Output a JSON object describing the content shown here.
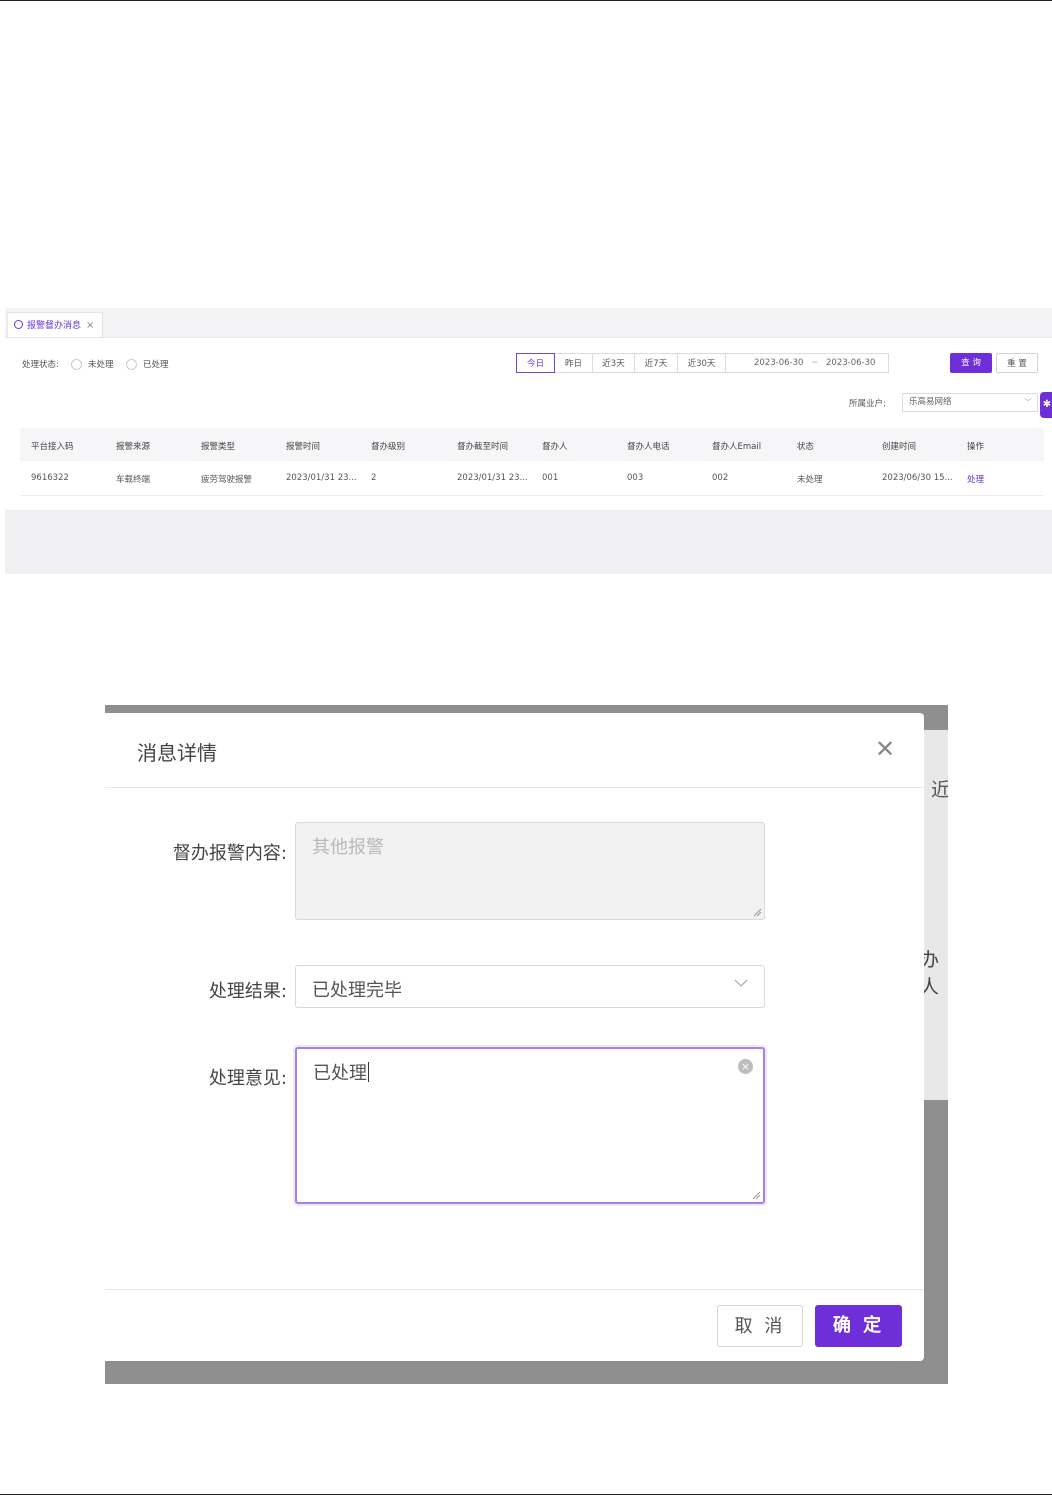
{
  "list_page": {
    "tab": {
      "label": "报警督办消息",
      "close": "×"
    },
    "filter": {
      "status_label": "处理状态:",
      "status_options": [
        "未处理",
        "已处理"
      ],
      "quick_dates": [
        "今日",
        "昨日",
        "近3天",
        "近7天",
        "近30天"
      ],
      "date_from": "2023-06-30",
      "date_sep": "~",
      "date_to": "2023-06-30",
      "query_button": "查 询",
      "reset_button": "重 置",
      "tenant_label": "所属业户:",
      "tenant_value": "乐高易网络"
    },
    "table": {
      "columns": [
        "平台接入码",
        "报警来源",
        "报警类型",
        "报警时间",
        "督办级别",
        "督办截至时间",
        "督办人",
        "督办人电话",
        "督办人Email",
        "状态",
        "创建时间",
        "操作"
      ],
      "rows": [
        [
          "9616322",
          "车载终端",
          "疲劳驾驶报警",
          "2023/01/31 23...",
          "2",
          "2023/01/31 23...",
          "001",
          "003",
          "002",
          "未处理",
          "2023/06/30 15...",
          "处理"
        ]
      ]
    }
  },
  "dialog": {
    "title": "消息详情",
    "content_label": "督办报警内容:",
    "content_value": "其他报警",
    "result_label": "处理结果:",
    "result_value": "已处理完毕",
    "opinion_label": "处理意见:",
    "opinion_value": "已处理",
    "cancel_button": "取 消",
    "ok_button": "确 定",
    "background_text_1": "近",
    "background_text_2": "办人"
  },
  "colors": {
    "accent": "#6f2fd8",
    "focus_border": "#a782e6"
  }
}
